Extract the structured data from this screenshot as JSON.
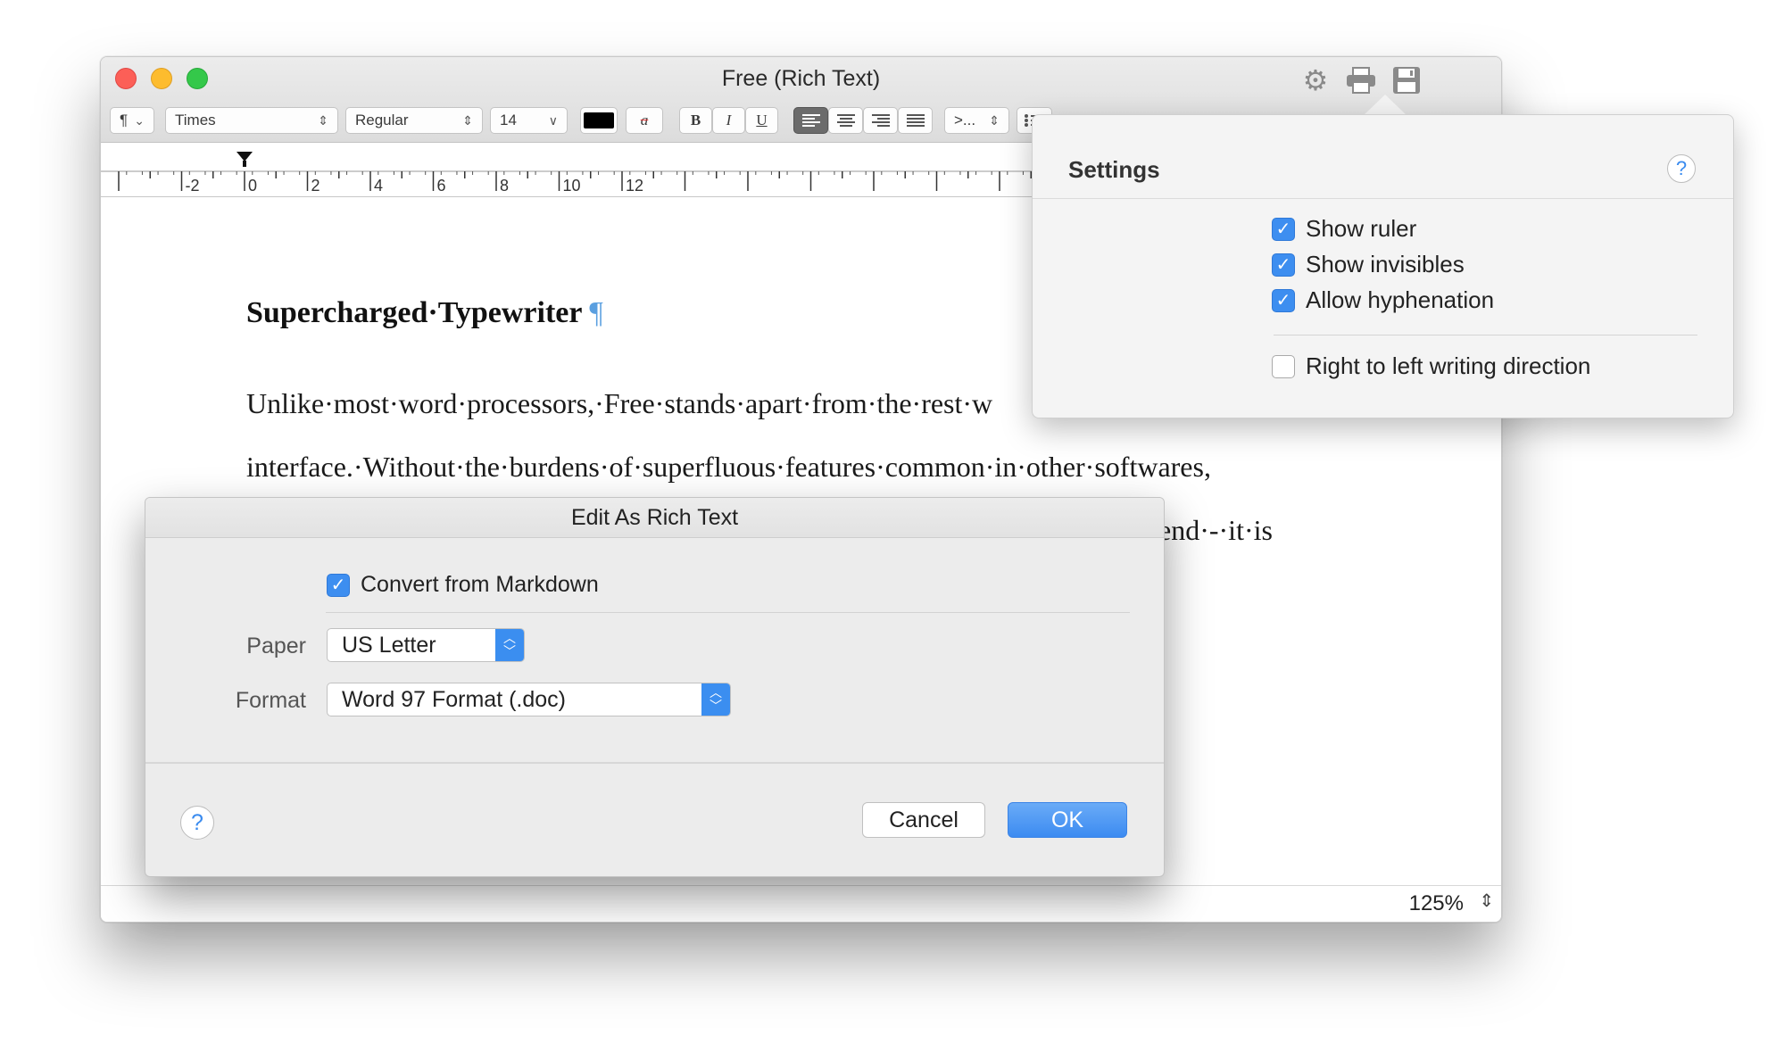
{
  "window": {
    "title": "Free (Rich Text)"
  },
  "toolbar": {
    "paragraph_style": "¶",
    "font_family": "Times",
    "font_style": "Regular",
    "font_size": "14",
    "bold": "B",
    "italic": "I",
    "underline": "U",
    "strike_char": "a",
    "more": ">..."
  },
  "ruler": {
    "labels": [
      "-2",
      "0",
      "2",
      "4",
      "6",
      "8",
      "10",
      "12"
    ]
  },
  "document": {
    "heading": "Supercharged·Typewriter",
    "pilcrow": "¶",
    "line1": "Unlike·most·word·processors,·Free·stands·apart·from·the·rest·w",
    "line2": "interface.·Without·the·burdens·of·superfluous·features·common·in·other·softwares,",
    "line3": "end·-·it·is"
  },
  "status": {
    "zoom": "125%"
  },
  "settings": {
    "title": "Settings",
    "help": "?",
    "options": [
      {
        "label": "Show ruler",
        "checked": true
      },
      {
        "label": "Show invisibles",
        "checked": true
      },
      {
        "label": "Allow hyphenation",
        "checked": true
      },
      {
        "label": "Right to left writing direction",
        "checked": false
      }
    ]
  },
  "dialog": {
    "title": "Edit As Rich Text",
    "convert_label": "Convert from Markdown",
    "convert_checked": true,
    "paper_label": "Paper",
    "paper_value": "US Letter",
    "format_label": "Format",
    "format_value": "Word 97 Format (.doc)",
    "help": "?",
    "cancel": "Cancel",
    "ok": "OK"
  },
  "colors": {
    "accent": "#3d8ef0",
    "close": "#fc5f57",
    "minimize": "#fdbc2e",
    "zoom": "#34c84a"
  }
}
